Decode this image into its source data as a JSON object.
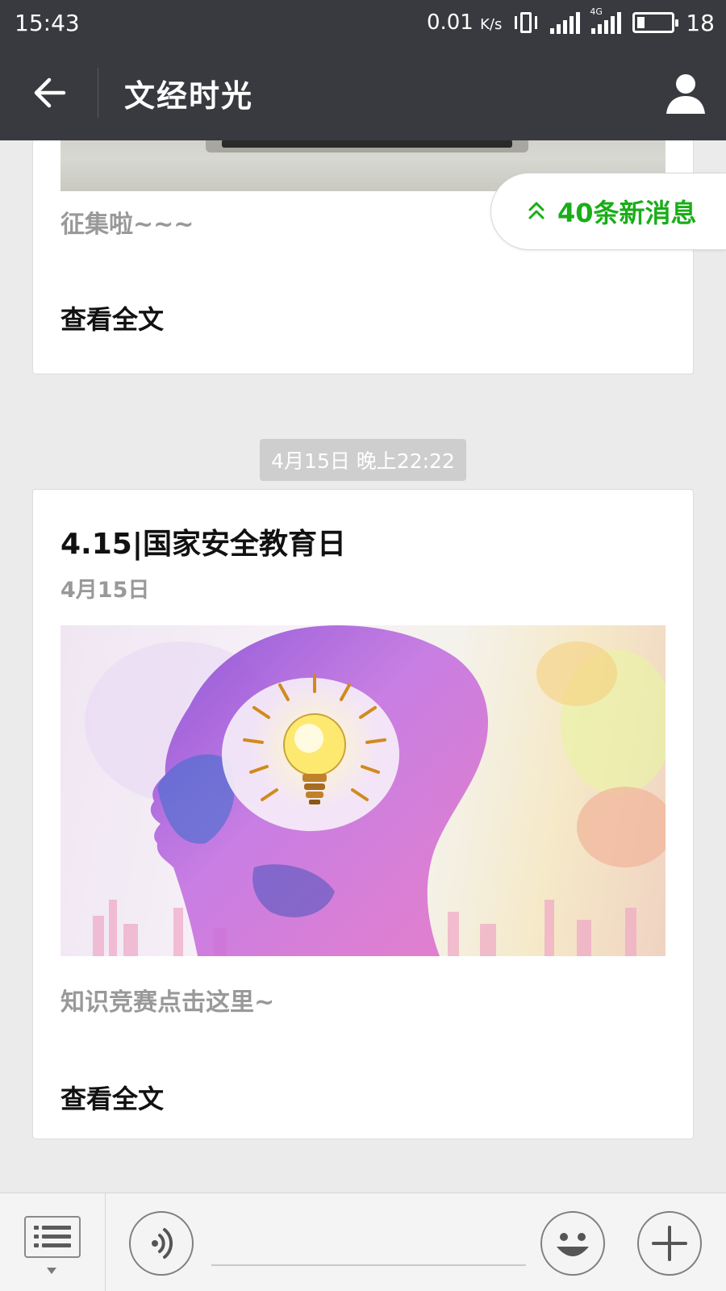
{
  "status_bar": {
    "time": "15:43",
    "net_speed": "0.01",
    "net_speed_unit": "K/s",
    "network_type": "4G",
    "battery_percent": "18",
    "battery_level": 0.18,
    "icons": [
      "vibrate-icon",
      "signal-icon",
      "signal-4g-icon",
      "battery-icon"
    ]
  },
  "header": {
    "back_icon": "back-arrow-icon",
    "title": "文经时光",
    "profile_icon": "person-icon"
  },
  "new_messages": {
    "icon": "double-chevron-up-icon",
    "label": "40条新消息",
    "color": "#1aad19"
  },
  "messages": [
    {
      "summary": "征集啦~~~",
      "read_more": "查看全文"
    },
    {
      "timestamp": "4月15日 晚上22:22",
      "title": "4.15|国家安全教育日",
      "date": "4月15日",
      "summary": "知识竞赛点击这里~",
      "read_more": "查看全文"
    }
  ],
  "bottom_bar": {
    "menu_icon": "list-menu-icon",
    "voice_icon": "voice-icon",
    "emoji_icon": "emoji-icon",
    "plus_icon": "plus-icon",
    "input_value": ""
  },
  "colors": {
    "header_bg": "#393a3f",
    "page_bg": "#ebebeb",
    "accent_green": "#1aad19"
  }
}
